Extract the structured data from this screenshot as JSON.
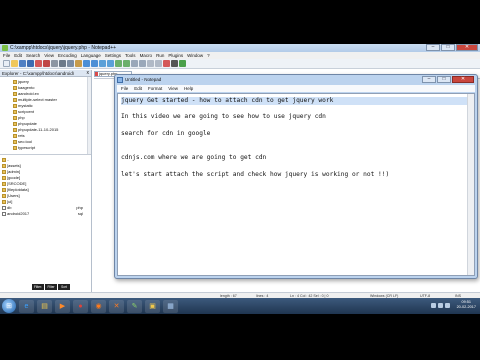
{
  "npp": {
    "title": "C:\\xampp\\htdocs\\jquery\\jquery.php - Notepad++",
    "window_buttons": [
      "–",
      "□",
      "✕"
    ],
    "menu": [
      "File",
      "Edit",
      "Search",
      "View",
      "Encoding",
      "Language",
      "Settings",
      "Tools",
      "Macro",
      "Run",
      "Plugins",
      "Window",
      "?"
    ],
    "explorer_title": "Explorer - C:\\xampp\\htdocs\\android\\",
    "explorer_close": "x",
    "tree": [
      "jquery",
      "kaagento",
      "aandroid.ex",
      "multiple-select master",
      "mystatic",
      "scripcent",
      "php",
      "phpupdate",
      "phpupdate-11-10-2015",
      "rets",
      "seo.tool",
      "typescript"
    ],
    "files": [
      {
        "name": "..",
        "ext": ""
      },
      {
        "name": "[assets]",
        "ext": ""
      },
      {
        "name": "[admin]",
        "ext": ""
      },
      {
        "name": "[gcode]",
        "ext": ""
      },
      {
        "name": "[SRCODE]",
        "ext": ""
      },
      {
        "name": "[fileplotdata]",
        "ext": ""
      },
      {
        "name": "[Users]",
        "ext": ""
      },
      {
        "name": "[ui]",
        "ext": ""
      },
      {
        "name": "db",
        "ext": "php"
      },
      {
        "name": "android2017",
        "ext": "sql"
      }
    ],
    "explorer_tools": [
      "Filter:",
      "Filter",
      "Sort"
    ],
    "doc_tab": "jquery.php",
    "status": {
      "length": "length : 67",
      "lines": "lines : 4",
      "pos": "Ln : 4   Col : 42   Sel : 0 | 0",
      "eol": "Windows (CR LF)",
      "encoding": "UTF-8",
      "mode": "INS"
    }
  },
  "notepad": {
    "title": "Untitled - Notepad",
    "window_buttons": [
      "–",
      "□",
      "✕"
    ],
    "menu": [
      "File",
      "Edit",
      "Format",
      "View",
      "Help"
    ],
    "lines": [
      "jquery Get started - how to attach cdn to get jquery work",
      "",
      "In this video we are going to see how to use jquery cdn",
      "",
      "search for cdn in google",
      "",
      "",
      "cdnjs.com where we are going to get cdn",
      "",
      "let's start attach the script and check how jquery is working or not !!)"
    ]
  },
  "taskbar": {
    "start_glyph": "⊞",
    "apps": [
      {
        "name": "ie-icon",
        "glyph": "e",
        "color": "#3aa0ff"
      },
      {
        "name": "explorer-icon",
        "glyph": "▤",
        "color": "#f2c94c"
      },
      {
        "name": "media-player-icon",
        "glyph": "▶",
        "color": "#ff8a2a"
      },
      {
        "name": "chrome-icon",
        "glyph": "●",
        "color": "#e0423a"
      },
      {
        "name": "firefox-icon",
        "glyph": "◉",
        "color": "#ff7a1a"
      },
      {
        "name": "xampp-icon",
        "glyph": "✕",
        "color": "#fb7a24"
      },
      {
        "name": "notepadpp-icon",
        "glyph": "✎",
        "color": "#8bd16a"
      },
      {
        "name": "folder-icon",
        "glyph": "▣",
        "color": "#f2c94c"
      },
      {
        "name": "notepad-icon",
        "glyph": "▦",
        "color": "#a9c9f0"
      }
    ],
    "time": "09:51",
    "date": "20-02-2017"
  }
}
